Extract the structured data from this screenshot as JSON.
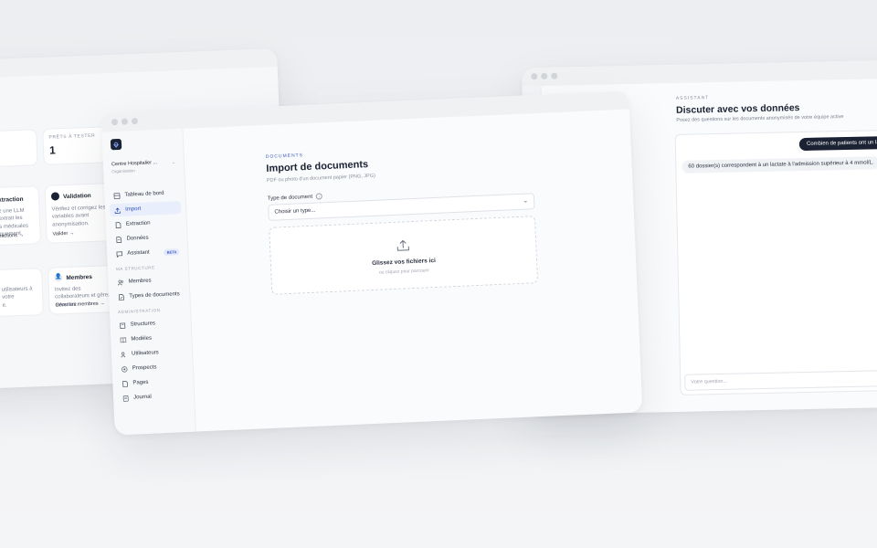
{
  "back_window": {
    "stat_label_left": "S",
    "stat_label": "PRÊTS À TESTER",
    "stat_value": "1",
    "extraction": {
      "title": "xtraction",
      "desc": [
        "z une LLM extrait les",
        "s médicales",
        "quement."
      ],
      "link": "ractions"
    },
    "validation": {
      "title": "Validation",
      "desc": [
        "Vérifiez et corrigez les",
        "variables avant",
        "anonymisation."
      ],
      "link": "Valider"
    },
    "membres_left": {
      "desc": [
        "utilisateurs à votre",
        "e."
      ]
    },
    "membres": {
      "title": "Membres",
      "desc": [
        "Invitez des collaborateurs et gérez",
        "structure."
      ],
      "link": "Gérer les membres"
    }
  },
  "front_window": {
    "org": {
      "name": "Centre Hospitalier ...",
      "role": "Organisation"
    },
    "nav": [
      {
        "label": "Tableau de bord",
        "icon": "dashboard-icon"
      },
      {
        "label": "Import",
        "icon": "upload-icon",
        "active": true
      },
      {
        "label": "Extraction",
        "icon": "document-icon"
      },
      {
        "label": "Données",
        "icon": "database-icon"
      },
      {
        "label": "Assistant",
        "icon": "chat-icon",
        "badge": "BETA"
      }
    ],
    "section_structure": "MA STRUCTURE",
    "nav_structure": [
      {
        "label": "Membres",
        "icon": "users-icon"
      },
      {
        "label": "Types de documents",
        "icon": "file-types-icon"
      }
    ],
    "section_admin": "ADMINISTRATION",
    "nav_admin": [
      {
        "label": "Structures",
        "icon": "building-icon"
      },
      {
        "label": "Modèles",
        "icon": "book-icon"
      },
      {
        "label": "Utilisateurs",
        "icon": "users-icon"
      },
      {
        "label": "Prospects",
        "icon": "target-icon"
      },
      {
        "label": "Pages",
        "icon": "page-icon"
      },
      {
        "label": "Journal",
        "icon": "journal-icon"
      }
    ],
    "eyebrow": "DOCUMENTS",
    "title": "Import de documents",
    "subtitle": "PDF ou photo d'un document papier (PNG, JPG)",
    "type_label": "Type de document",
    "type_placeholder": "Choisir un type...",
    "drop_title": "Glissez vos fichiers ici",
    "drop_sub": "ou cliquez pour parcourir"
  },
  "right_window": {
    "eyebrow": "ASSISTANT",
    "title": "Discuter avec vos données",
    "subtitle": "Posez des questions sur les documents anonymisés de votre équipe active",
    "user_message": "Combien de patients ont un lactate à l'admi",
    "assistant_message": "60 dossier(s) correspondent à un lactate à l'admission supérieur à 4 mmol/L.",
    "input_placeholder": "Votre question..."
  },
  "colors": {
    "accent": "#2a4fb8",
    "dark": "#1b2233"
  }
}
